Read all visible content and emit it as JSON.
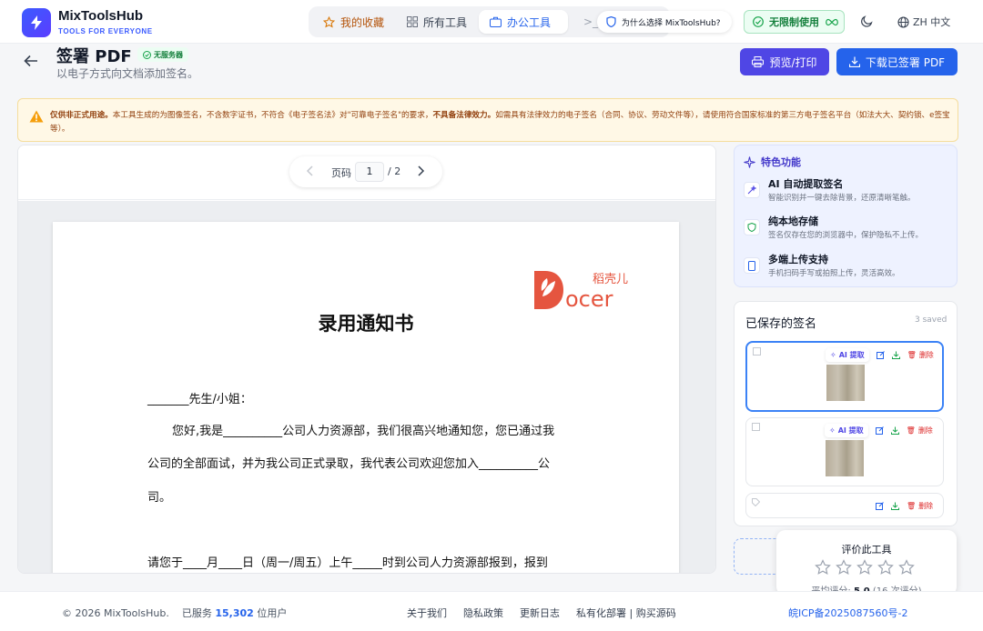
{
  "brand": {
    "name": "MixToolsHub",
    "tagline": "TOOLS FOR EVERYONE"
  },
  "nav": {
    "favorites": "我的收藏",
    "all_tools": "所有工具",
    "office_tools": "办公工具",
    "more_glyph": ">_",
    "why": "为什么选择 MixToolsHub?",
    "unlimited": "无限制使用",
    "lang": "ZH 中文"
  },
  "page": {
    "title": "签署 PDF",
    "badge": "无服务器",
    "subtitle": "以电子方式向文档添加签名。",
    "preview_button": "预览/打印",
    "download_button": "下载已签署 PDF"
  },
  "warning": {
    "lead": "仅供非正式用途。",
    "text_a": "本工具生成的为图像签名，不含数字证书，不符合《电子签名法》对\"可靠电子签名\"的要求，",
    "bold": "不具备法律效力。",
    "text_b": "如需具有法律效力的电子签名（合同、协议、劳动文件等），请使用符合国家标准的第三方电子签名平台（如法大大、契约锁、e签宝等）。"
  },
  "pager": {
    "label": "页码",
    "current": "1",
    "total": "/ 2"
  },
  "document": {
    "logo_text": "稻壳儿",
    "title": "录用通知书",
    "lines": [
      "_______先生/小姐：",
      "您好,我是__________公司人力资源部，我们很高兴地通知您，您已通过我",
      "公司的全部面试，并为我公司正式录取，我代表公司欢迎您加入__________公",
      "司。",
      "请您于____月____日（周一/周五）上午_____时到公司人力资源部报到，报到"
    ]
  },
  "features": {
    "heading": "特色功能",
    "items": [
      {
        "title": "AI 自动提取签名",
        "desc": "智能识别并一键去除背景，还原清晰笔触。"
      },
      {
        "title": "纯本地存储",
        "desc": "签名仅存在您的浏览器中，保护隐私不上传。"
      },
      {
        "title": "多端上传支持",
        "desc": "手机扫码手写或拍照上传，灵活高效。"
      }
    ]
  },
  "saved": {
    "title": "已保存的签名",
    "count": "3 saved",
    "ai_label": "AI 提取",
    "delete_label": "删除"
  },
  "rating": {
    "title": "评价此工具",
    "avg_prefix": "平均评分:",
    "avg_value": "5.0",
    "avg_suffix": "(16 次评分)",
    "stars": 5
  },
  "footer": {
    "copyright": "© 2026 MixToolsHub.",
    "served_prefix": "已服务",
    "served_count": "15,302",
    "served_suffix": "位用户",
    "links": [
      "关于我们",
      "隐私政策",
      "更新日志",
      "私有化部署 | 购买源码"
    ],
    "icp": "皖ICP备2025087560号-2"
  },
  "colors": {
    "primary": "#2563eb",
    "accent": "#4f46e5",
    "success": "#15803d",
    "warning_bg": "#fff8e6",
    "danger": "#dc2626"
  }
}
